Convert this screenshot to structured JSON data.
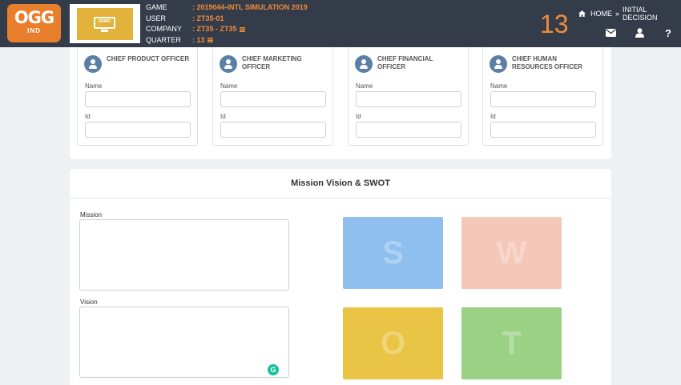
{
  "brand": {
    "logo_main": "OGG",
    "logo_sub": "IND",
    "banner_label": "DEMO"
  },
  "header": {
    "game_label": "GAME",
    "game_value": ": 2019044-INTL SIMULATION 2019",
    "user_label": "USER",
    "user_value": ": ZT35-01",
    "company_label": "COMPANY",
    "company_value": ": ZT35 - ZT35",
    "quarter_label": "QUARTER",
    "quarter_value": ": 13",
    "quarter_big": "13"
  },
  "breadcrumb": {
    "home": "HOME",
    "separator": "»",
    "current": "INITIAL DECISION"
  },
  "header_icons": [
    "envelope-icon",
    "user-icon",
    "help-icon"
  ],
  "officers": [
    {
      "title": "CHIEF PRODUCT OFFICER",
      "name_label": "Name",
      "id_label": "Id",
      "name_value": "",
      "id_value": ""
    },
    {
      "title": "CHIEF MARKETING OFFICER",
      "name_label": "Name",
      "id_label": "Id",
      "name_value": "",
      "id_value": ""
    },
    {
      "title": "CHIEF FINANCIAL OFFICER",
      "name_label": "Name",
      "id_label": "Id",
      "name_value": "",
      "id_value": ""
    },
    {
      "title": "CHIEF HUMAN RESOURCES OFFICER",
      "name_label": "Name",
      "id_label": "Id",
      "name_value": "",
      "id_value": ""
    }
  ],
  "mission_panel": {
    "title": "Mission Vision & SWOT",
    "mission_label": "Mission",
    "mission_value": "",
    "vision_label": "Vision",
    "vision_value": ""
  },
  "swot": [
    {
      "letter": "S",
      "color": "#8fbfef"
    },
    {
      "letter": "W",
      "color": "#f5c7b8"
    },
    {
      "letter": "O",
      "color": "#e9c445"
    },
    {
      "letter": "T",
      "color": "#9ad184"
    }
  ],
  "colors": {
    "topbar": "#343c4a",
    "accent": "#f08c3a",
    "logo": "#e97e2c",
    "avatar": "#5b7fa6"
  }
}
